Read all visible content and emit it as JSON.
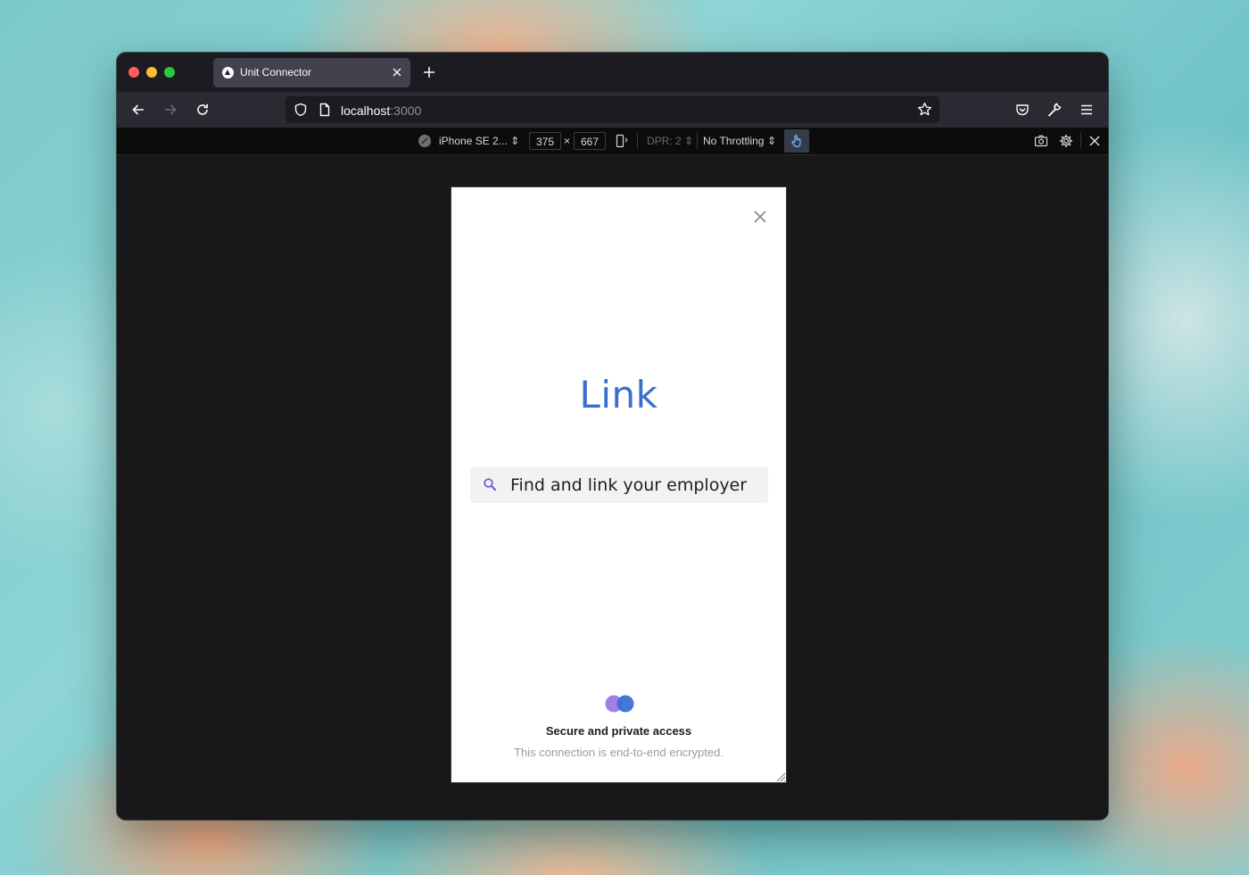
{
  "browser": {
    "tab": {
      "title": "Unit Connector",
      "favicon": "triangle-logo-icon"
    },
    "url": {
      "host": "localhost",
      "port": ":3000"
    }
  },
  "rdm_toolbar": {
    "device": "iPhone SE 2...",
    "width": "375",
    "times": "×",
    "height": "667",
    "dpr": "DPR: 2",
    "throttling": "No Throttling"
  },
  "page": {
    "title": "Link",
    "search": {
      "placeholder": "Find and link your employer"
    },
    "footer": {
      "title": "Secure and private access",
      "subtitle": "This connection is end-to-end encrypted."
    }
  },
  "colors": {
    "accent": "#3a6fcf",
    "logo_left": "#a27fe0",
    "logo_right": "#3b6fd6"
  }
}
